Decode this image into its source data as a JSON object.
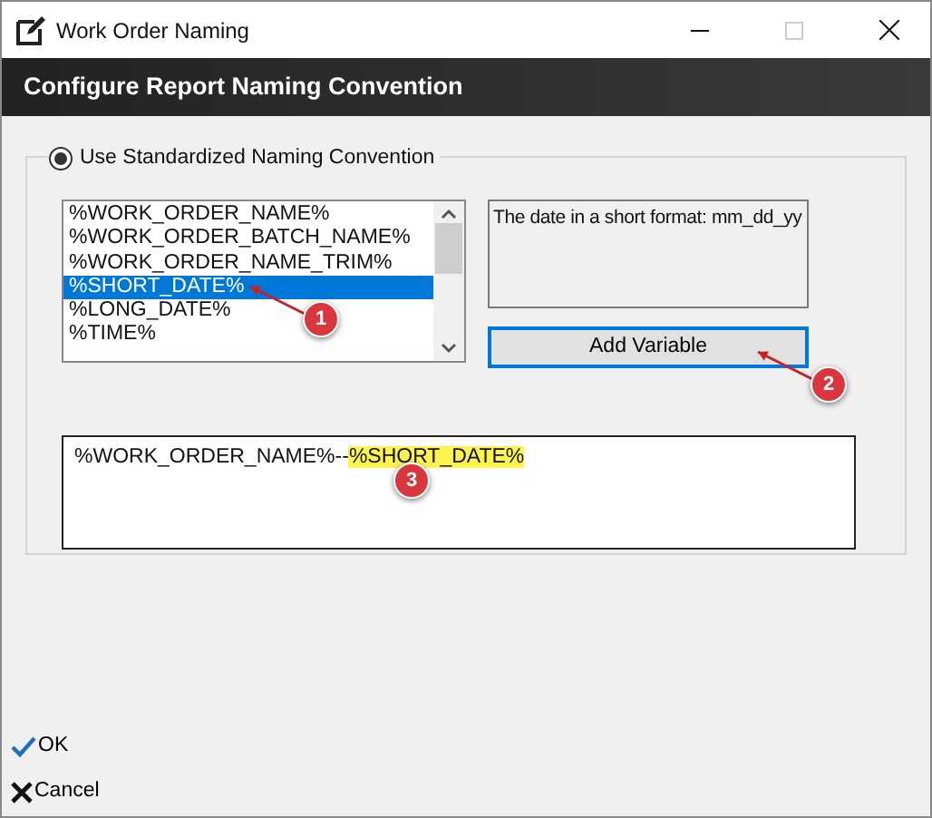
{
  "window": {
    "title": "Work Order Naming"
  },
  "header": {
    "title": "Configure Report Naming Convention"
  },
  "mode": {
    "label": "Use Standardized Naming Convention",
    "selected": true
  },
  "variables": [
    {
      "label": "%WORK_ORDER_NAME%",
      "selected": false
    },
    {
      "label": "%WORK_ORDER_BATCH_NAME%",
      "selected": false
    },
    {
      "label": "%WORK_ORDER_NAME_TRIM%",
      "selected": false
    },
    {
      "label": "%SHORT_DATE%",
      "selected": true
    },
    {
      "label": "%LONG_DATE%",
      "selected": false
    },
    {
      "label": "%TIME%",
      "selected": false
    }
  ],
  "description": "The date in a short format: mm_dd_yy",
  "add_button": {
    "label": "Add Variable",
    "focused": true
  },
  "result": [
    {
      "text": "%WORK_ORDER_NAME%--",
      "highlighted": false
    },
    {
      "text": "%SHORT_DATE%",
      "highlighted": true
    }
  ],
  "annotations": [
    {
      "label": "1"
    },
    {
      "label": "2"
    },
    {
      "label": "3"
    }
  ],
  "buttons": [
    {
      "kind": "ok",
      "label": "OK"
    },
    {
      "kind": "cancel",
      "label": "Cancel"
    }
  ]
}
